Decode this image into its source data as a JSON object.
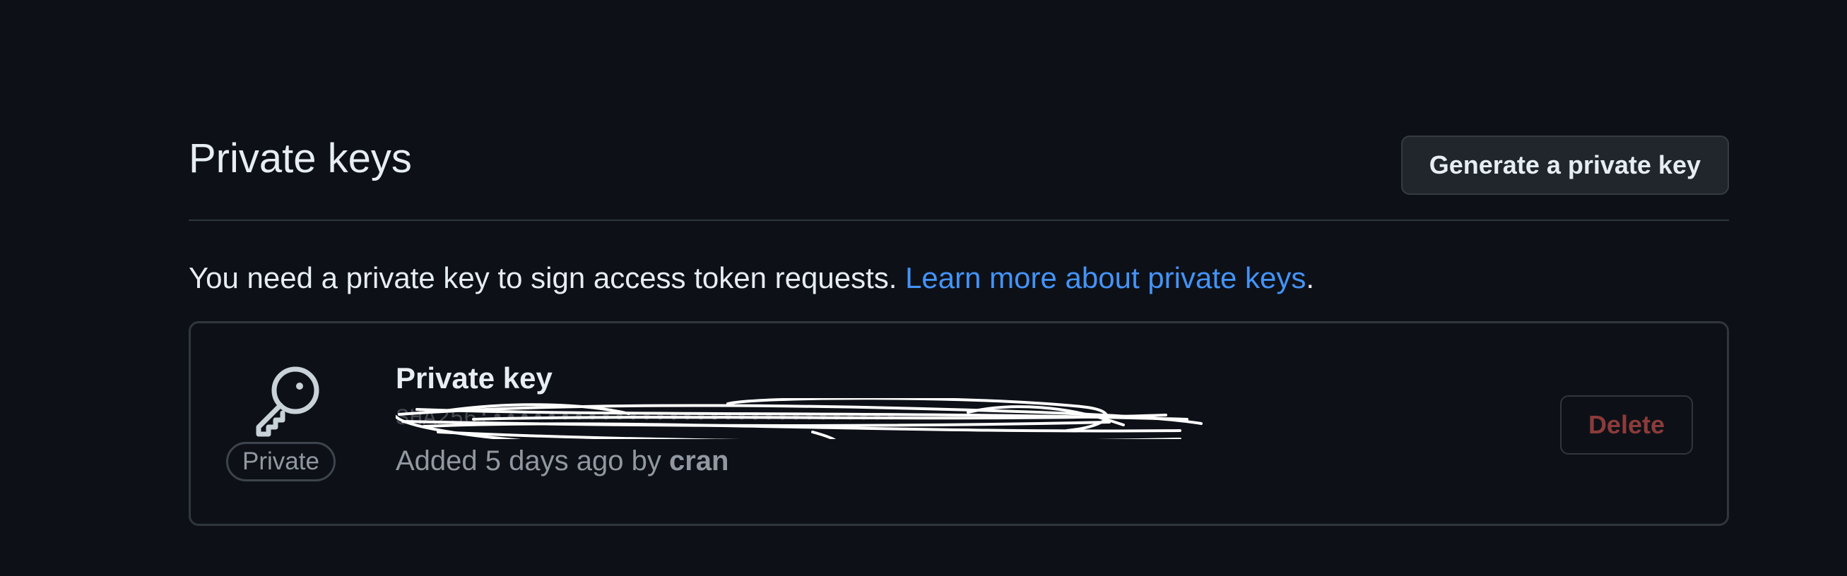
{
  "header": {
    "title": "Private keys",
    "generate_button_label": "Generate a private key"
  },
  "description": {
    "text": "You need a private key to sign access token requests. ",
    "link_text": "Learn more about private keys",
    "suffix": "."
  },
  "key": {
    "icon": "key-icon",
    "badge": "Private",
    "name": "Private key",
    "fingerprint": "SHA256:••••••••••••••••••••••••••••••",
    "added_prefix": "Added 5 days ago by ",
    "added_by": "cran",
    "delete_label": "Delete"
  },
  "colors": {
    "background": "#0d1117",
    "text": "#e6edf3",
    "muted": "#9198a1",
    "link": "#4493f8",
    "border": "#30363d",
    "danger": "#8c3b3a"
  }
}
